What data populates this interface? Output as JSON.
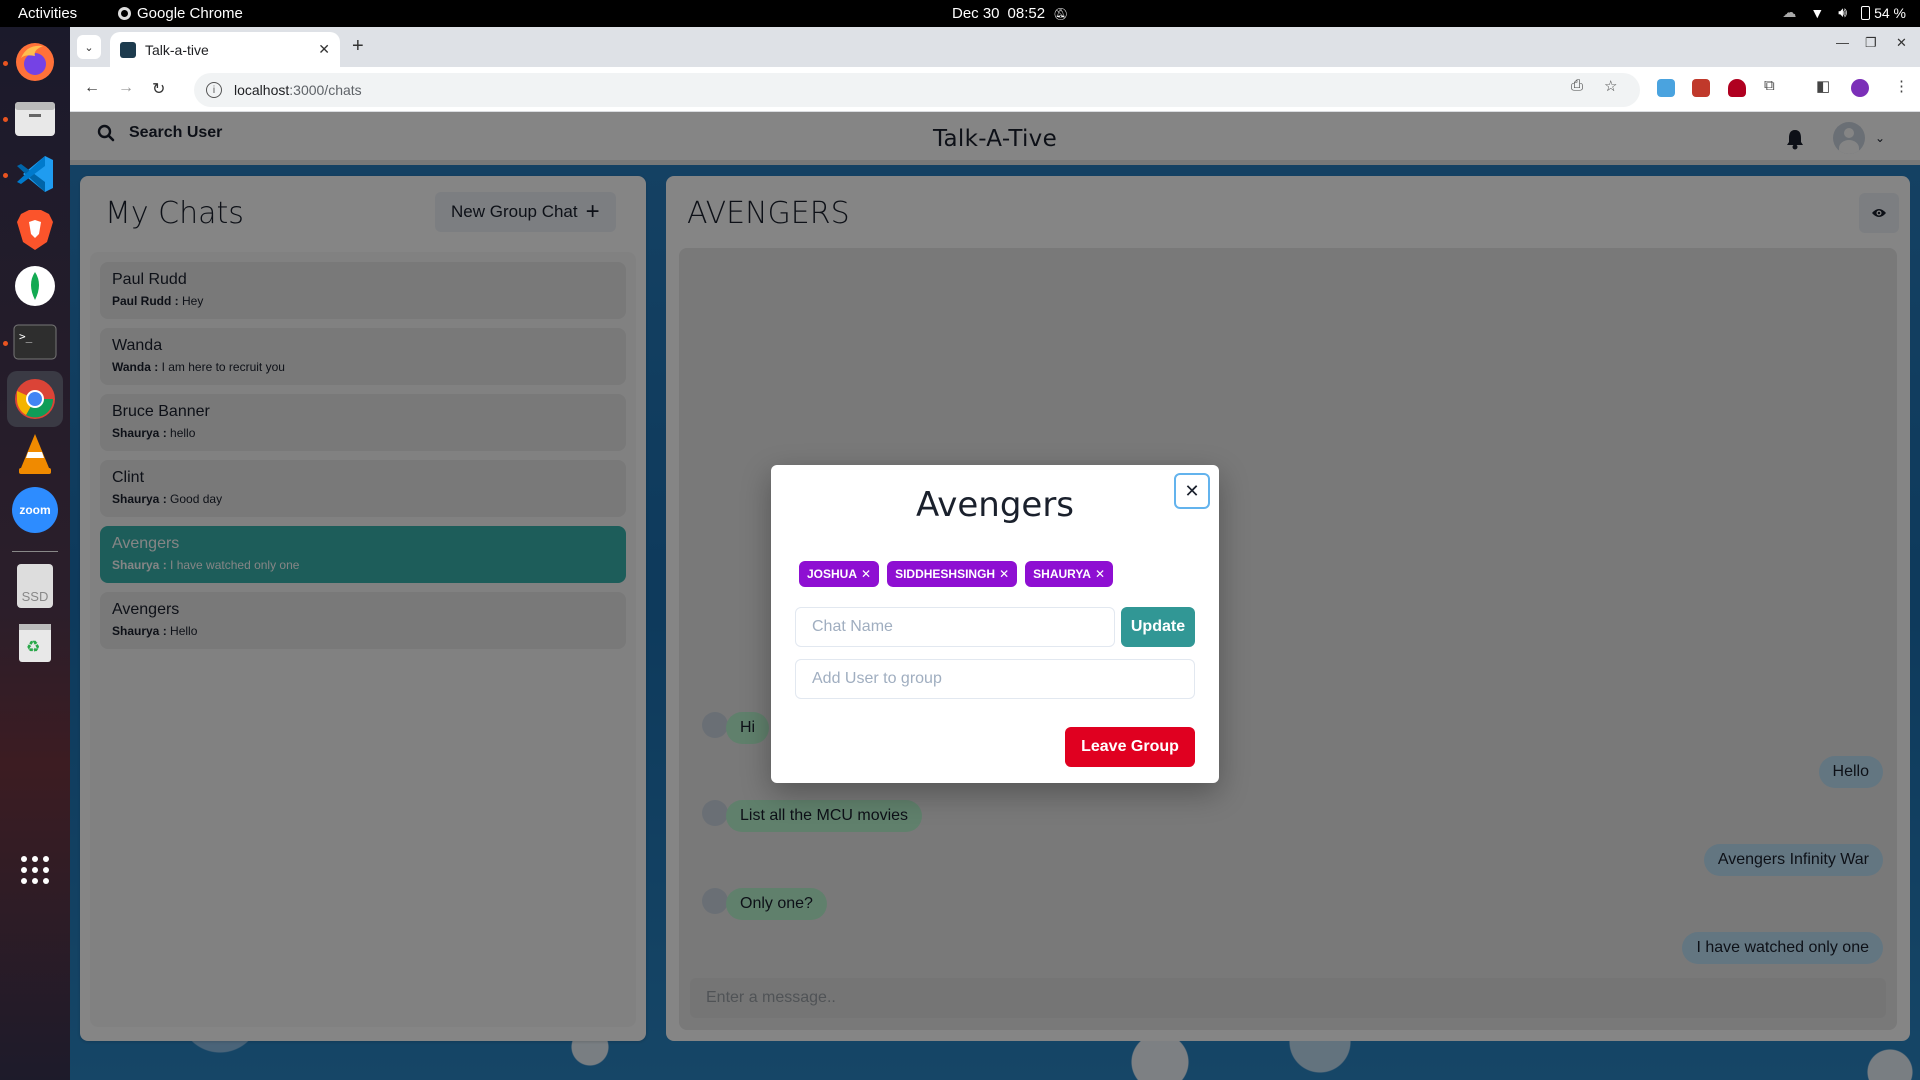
{
  "topbar": {
    "activities": "Activities",
    "app_name": "Google Chrome",
    "date": "Dec 30",
    "time": "08:52",
    "battery": "54 %"
  },
  "dock": {
    "items": [
      "firefox-icon",
      "files-icon",
      "vscode-icon",
      "brave-icon",
      "mongodb-compass-icon",
      "terminal-icon",
      "chrome-icon",
      "vlc-icon",
      "zoom-icon",
      "ssd-drive-icon",
      "trash-icon"
    ],
    "zoom_label": "zoom",
    "ssd_label": "SSD"
  },
  "browser": {
    "tab_title": "Talk-a-tive",
    "url_host": "localhost",
    "url_path": ":3000/chats"
  },
  "header": {
    "search_label": "Search User",
    "app_title": "Talk-A-Tive"
  },
  "mychats": {
    "title": "My Chats",
    "new_group_label": "New Group Chat",
    "chats": [
      {
        "name": "Paul Rudd",
        "sender": "Paul Rudd :",
        "message": "Hey",
        "active": false
      },
      {
        "name": "Wanda",
        "sender": "Wanda :",
        "message": "I am here to recruit you",
        "active": false
      },
      {
        "name": "Bruce Banner",
        "sender": "Shaurya :",
        "message": "hello",
        "active": false
      },
      {
        "name": "Clint",
        "sender": "Shaurya :",
        "message": "Good day",
        "active": false
      },
      {
        "name": "Avengers",
        "sender": "Shaurya :",
        "message": "I have watched only one",
        "active": true
      },
      {
        "name": "Avengers",
        "sender": "Shaurya :",
        "message": "Hello",
        "active": false
      }
    ]
  },
  "chatbox": {
    "title": "AVENGERS",
    "messages": [
      {
        "text": "Hi",
        "side": "received"
      },
      {
        "text": "Hello",
        "side": "sent"
      },
      {
        "text": "List all the MCU movies",
        "side": "received"
      },
      {
        "text": "Avengers Infinity War",
        "side": "sent"
      },
      {
        "text": "Only one?",
        "side": "received"
      },
      {
        "text": "I have watched only one",
        "side": "sent"
      }
    ],
    "input_placeholder": "Enter a message.."
  },
  "modal": {
    "title": "Avengers",
    "members": [
      "JOSHUA",
      "SIDDHESHSINGH",
      "SHAURYA"
    ],
    "chat_name_placeholder": "Chat Name",
    "update_label": "Update",
    "add_user_placeholder": "Add User to group",
    "leave_label": "Leave Group"
  },
  "colors": {
    "accent_teal": "#38b2ac",
    "badge_purple": "#8e0fd2",
    "leave_red": "#e00020",
    "received_bubble": "#b9f5d0",
    "sent_bubble": "#bee3f8"
  }
}
